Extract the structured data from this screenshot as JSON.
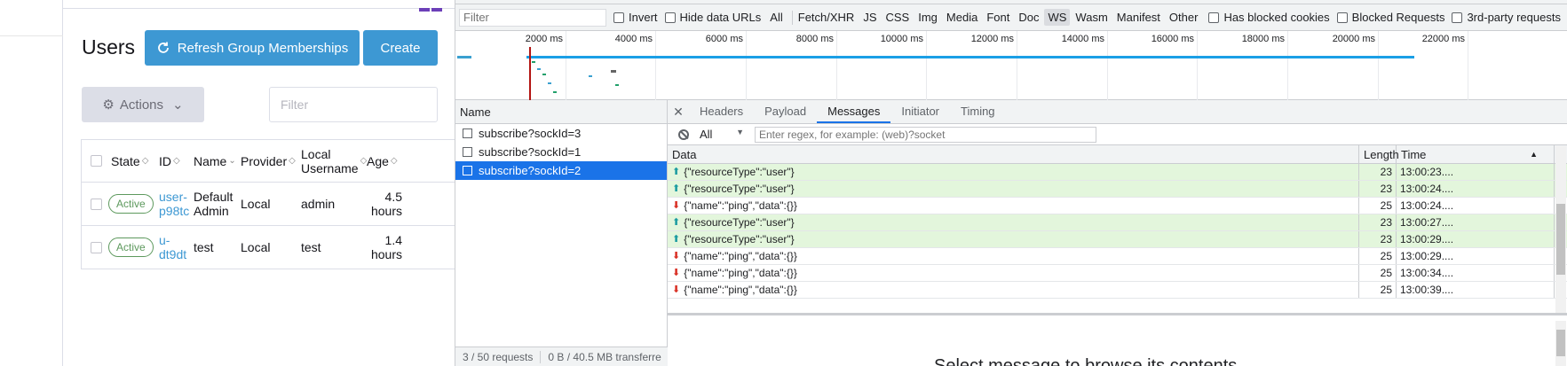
{
  "app": {
    "page_title": "Users",
    "refresh_label": "Refresh Group Memberships",
    "create_label": "Create",
    "actions_label": "Actions",
    "filter_placeholder": "Filter",
    "table": {
      "headers": [
        "State",
        "ID",
        "Name",
        "Provider",
        "Local Username",
        "Age"
      ],
      "rows": [
        {
          "state": "Active",
          "id": "user-p98tc",
          "name": "Default Admin",
          "provider": "Local",
          "username": "admin",
          "age": "4.5 hours"
        },
        {
          "state": "Active",
          "id": "u-dt9dt",
          "name": "test",
          "provider": "Local",
          "username": "test",
          "age": "1.4 hours"
        }
      ]
    },
    "colors": {
      "primary": "#3d98d3",
      "active_badge": "#5d995d",
      "logo": "#6c3fb8"
    }
  },
  "devtools": {
    "filter_placeholder": "Filter",
    "filter_options": {
      "invert": "Invert",
      "hide_data_urls": "Hide data URLs",
      "types": [
        "All",
        "Fetch/XHR",
        "JS",
        "CSS",
        "Img",
        "Media",
        "Font",
        "Doc",
        "WS",
        "Wasm",
        "Manifest",
        "Other"
      ],
      "active_type": "WS",
      "has_blocked_cookies": "Has blocked cookies",
      "blocked_requests": "Blocked Requests",
      "third_party": "3rd-party requests"
    },
    "timeline_ticks": [
      "2000 ms",
      "4000 ms",
      "6000 ms",
      "8000 ms",
      "10000 ms",
      "12000 ms",
      "14000 ms",
      "16000 ms",
      "18000 ms",
      "20000 ms",
      "22000 ms"
    ],
    "name_header": "Name",
    "requests": [
      "subscribe?sockId=3",
      "subscribe?sockId=1",
      "subscribe?sockId=2"
    ],
    "selected_request": "subscribe?sockId=2",
    "status": {
      "requests": "3 / 50 requests",
      "transfer": "0 B / 40.5 MB transferre"
    },
    "tabs": [
      "Headers",
      "Payload",
      "Messages",
      "Initiator",
      "Timing"
    ],
    "active_tab": "Messages",
    "message_filter": {
      "selected": "All",
      "regex_placeholder": "Enter regex, for example: (web)?socket"
    },
    "message_columns": {
      "data": "Data",
      "length": "Length",
      "time": "Time"
    },
    "messages": [
      {
        "dir": "sent",
        "data": "{\"resourceType\":\"user\"}",
        "length": "23",
        "time": "13:00:23...."
      },
      {
        "dir": "sent",
        "data": "{\"resourceType\":\"user\"}",
        "length": "23",
        "time": "13:00:24...."
      },
      {
        "dir": "recv",
        "data": "{\"name\":\"ping\",\"data\":{}}",
        "length": "25",
        "time": "13:00:24...."
      },
      {
        "dir": "sent",
        "data": "{\"resourceType\":\"user\"}",
        "length": "23",
        "time": "13:00:27...."
      },
      {
        "dir": "sent",
        "data": "{\"resourceType\":\"user\"}",
        "length": "23",
        "time": "13:00:29...."
      },
      {
        "dir": "recv",
        "data": "{\"name\":\"ping\",\"data\":{}}",
        "length": "25",
        "time": "13:00:29...."
      },
      {
        "dir": "recv",
        "data": "{\"name\":\"ping\",\"data\":{}}",
        "length": "25",
        "time": "13:00:34...."
      },
      {
        "dir": "recv",
        "data": "{\"name\":\"ping\",\"data\":{}}",
        "length": "25",
        "time": "13:00:39...."
      }
    ],
    "preview_text": "Select message to browse its contents.",
    "colors": {
      "selected": "#1a73e8",
      "sent_row": "#e3f6dc",
      "timeline_bar": "#1a9fe6",
      "recv_arrow": "#d93025",
      "sent_arrow": "#1a9ba0"
    }
  }
}
